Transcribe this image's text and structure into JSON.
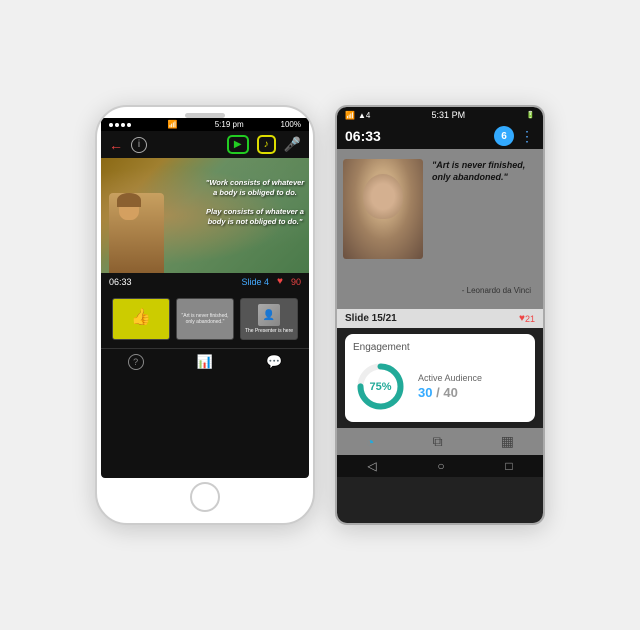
{
  "left_phone": {
    "status_bar": {
      "dots": 4,
      "wifi": "WiFi",
      "time": "5:19 pm",
      "battery": "100%"
    },
    "toolbar": {
      "back_icon": "←",
      "info_icon": "i",
      "video_label": "▶",
      "audio_label": "♪",
      "mic_icon": "🎤"
    },
    "slide": {
      "quote_line1": "\"Work consists of whatever a",
      "quote_line2": "body is obliged to do.",
      "quote_line3": "Play consists of whatever a",
      "quote_line4": "body is not obliged to do.\""
    },
    "info_bar": {
      "timer": "06:33",
      "slide_label": "Slide 4",
      "heart": "♥",
      "likes": "90"
    },
    "thumbnails": [
      {
        "id": 1,
        "type": "yellow_thumb"
      },
      {
        "id": 2,
        "type": "davinci_quote",
        "text": "Art is never finished, only abandoned."
      },
      {
        "id": 3,
        "type": "presenter",
        "label": "The Presenter is here"
      }
    ],
    "bottom_bar": {
      "help_icon": "?",
      "chart_icon": "📊",
      "chat_icon": "💬"
    }
  },
  "right_phone": {
    "status_bar": {
      "wifi": "WiFi",
      "signal": "▲4",
      "time": "5:31 PM",
      "battery_icon": "🔋"
    },
    "timer": "06:33",
    "badge": "6",
    "dots_icon": "⋮",
    "slide": {
      "quote": "\"Art is never finished, only abandoned.\"",
      "author": "- Leonardo da Vinci"
    },
    "slide_info": {
      "label": "Slide 15/21",
      "heart": "♥",
      "likes": "21"
    },
    "engagement": {
      "title": "Engagement",
      "percent": "75%",
      "active_label": "Active Audience",
      "count_main": "30",
      "separator": "/",
      "count_total": "40"
    },
    "bottom_nav": {
      "gauge_icon": "⊙",
      "copy_icon": "⧉",
      "slides_icon": "▦"
    },
    "android_nav": {
      "back": "◁",
      "home": "○",
      "recents": "□"
    }
  }
}
